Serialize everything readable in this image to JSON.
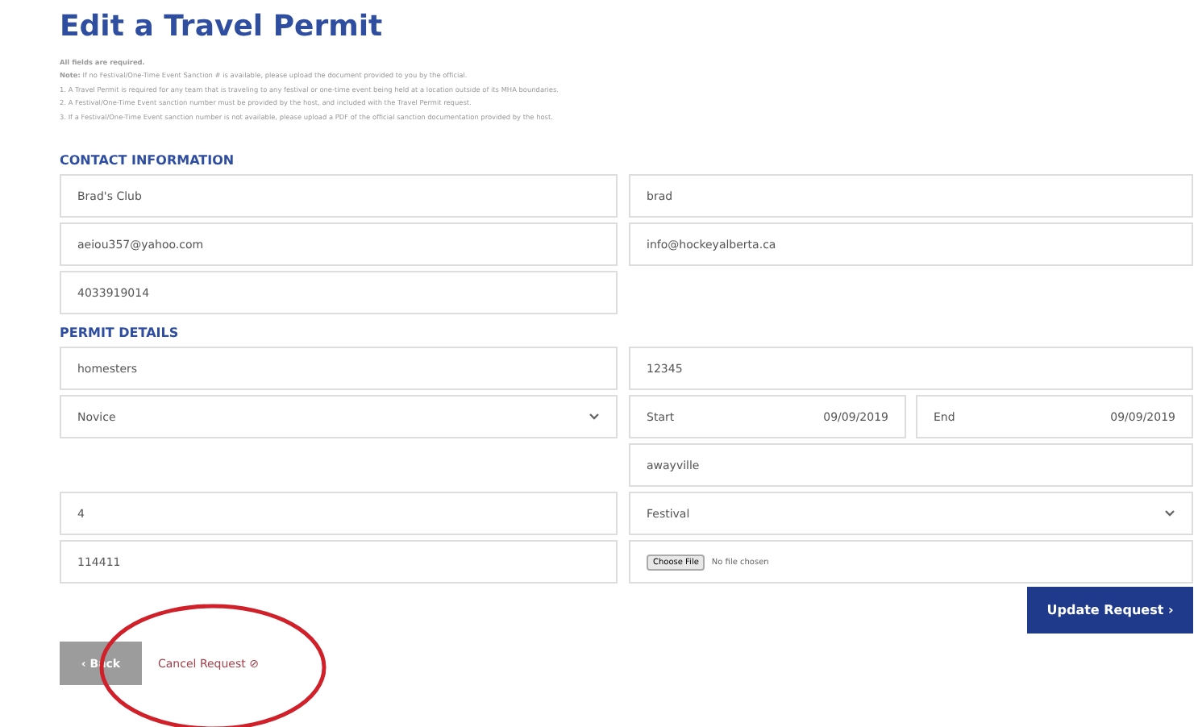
{
  "title": "Edit a Travel Permit",
  "instructions": [
    "**All fields are required.**",
    "**Note:** If no Festival/One-Time Event Sanction # is available, please upload the document provided to you by the official.",
    "1. A Travel Permit is required for any team that is traveling to any festival or one-time event being held at a location outside of its MHA boundaries.",
    "2. A Festival/One-Time Event sanction number must be provided by the host, and included with the Travel Permit request.",
    "3. If a Festival/One-Time Event sanction number is not available, please upload a PDF of the official sanction documentation provided by the host."
  ],
  "sections": [
    {
      "heading": "CONTACT INFORMATION",
      "rows": [
        [
          {
            "kind": "input",
            "value": "Brad's Club"
          },
          {
            "kind": "input",
            "value": "brad"
          }
        ],
        [
          {
            "kind": "input",
            "value": "aeiou357@yahoo.com"
          },
          {
            "kind": "input",
            "value": "info@hockeyalberta.ca"
          }
        ],
        [
          {
            "kind": "input",
            "value": "4033919014"
          },
          {
            "kind": "empty"
          }
        ]
      ]
    },
    {
      "heading": "PERMIT DETAILS",
      "rows": [
        [
          {
            "kind": "input",
            "value": "homesters"
          },
          {
            "kind": "input",
            "value": "12345"
          }
        ],
        [
          {
            "kind": "select",
            "value": "Novice"
          },
          {
            "kind": "dates",
            "start_label": "Start",
            "start": "09/09/2019",
            "end_label": "End",
            "end": "09/09/2019"
          }
        ],
        [
          {
            "kind": "empty"
          },
          {
            "kind": "input",
            "value": "awayville"
          }
        ],
        [
          {
            "kind": "input",
            "value": "4"
          },
          {
            "kind": "select",
            "value": "Festival"
          }
        ],
        [
          {
            "kind": "input",
            "value": "114411"
          },
          {
            "kind": "file",
            "button": "Choose File",
            "status": "No file chosen"
          }
        ]
      ]
    }
  ],
  "update_button": "Update Request ›",
  "back_button": "‹ Back",
  "cancel_link": "Cancel Request ⊘",
  "annotation": {
    "kind": "ellipse",
    "color": "#d0202a"
  }
}
